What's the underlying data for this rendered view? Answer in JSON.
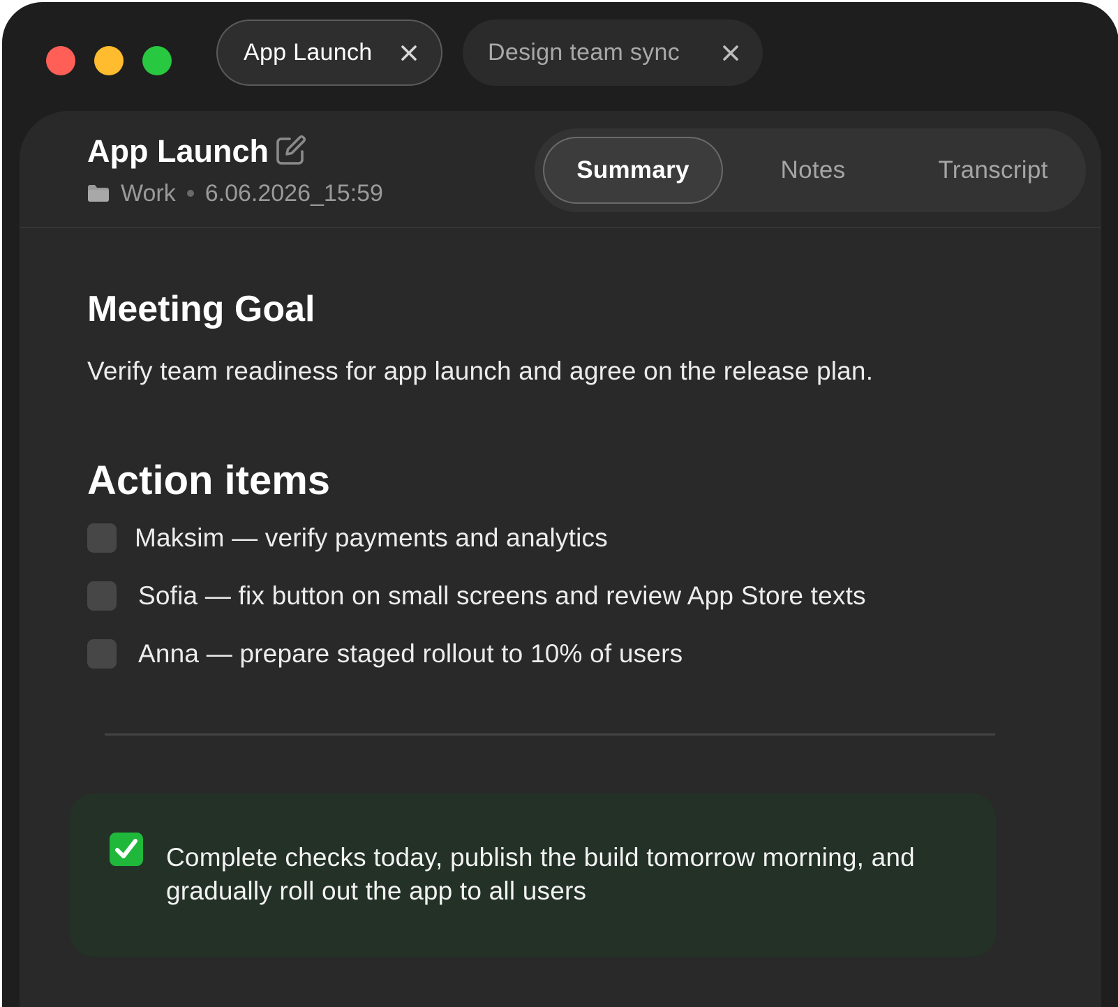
{
  "tabs": [
    {
      "label": "App Launch",
      "active": true
    },
    {
      "label": "Design team sync",
      "active": false
    }
  ],
  "document": {
    "title": "App Launch",
    "folder": "Work",
    "timestamp": "6.06.2026_15:59"
  },
  "view_tabs": [
    {
      "label": "Summary",
      "active": true
    },
    {
      "label": "Notes",
      "active": false
    },
    {
      "label": "Transcript",
      "active": false
    }
  ],
  "meeting_goal": {
    "heading": "Meeting Goal",
    "text": "Verify team readiness for app launch and agree on the release plan."
  },
  "action_items": {
    "heading": "Action items",
    "items": [
      {
        "text": "Maksim — verify payments and analytics",
        "checked": false
      },
      {
        "text": "Sofia — fix button on small screens and review App Store texts",
        "checked": false
      },
      {
        "text": "Anna — prepare staged rollout to 10% of users",
        "checked": false
      }
    ]
  },
  "callout": {
    "icon": "check-mark-button-emoji",
    "text": "Complete checks today, publish the build tomorrow morning, and gradually roll out the app to all users"
  },
  "colors": {
    "window_bg": "#1e1e1e",
    "panel_bg": "#292929",
    "callout_bg": "#233126",
    "check_green": "#1fb83b",
    "traffic_red": "#ff5f57",
    "traffic_yellow": "#febc2e",
    "traffic_green": "#28c840"
  }
}
